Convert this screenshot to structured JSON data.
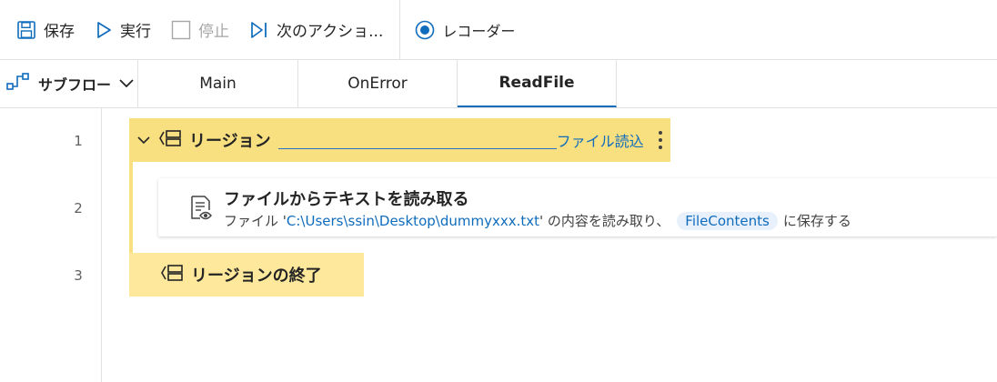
{
  "toolbar": {
    "save_label": "保存",
    "run_label": "実行",
    "stop_label": "停止",
    "next_action_label": "次のアクショ...",
    "recorder_label": "レコーダー"
  },
  "subflow": {
    "label": "サブフロー"
  },
  "tabs": [
    {
      "label": "Main",
      "active": false
    },
    {
      "label": "OnError",
      "active": false
    },
    {
      "label": "ReadFile",
      "active": true
    }
  ],
  "lines": [
    "1",
    "2",
    "3"
  ],
  "region": {
    "title": "リージョン",
    "name": "ファイル読込",
    "end_title": "リージョンの終了"
  },
  "action": {
    "title": "ファイルからテキストを読み取る",
    "desc_prefix": "ファイル '",
    "file_path": "C:\\Users\\ssin\\Desktop\\dummyxxx.txt",
    "desc_middle": "' の内容を読み取り、",
    "variable": "FileContents",
    "desc_suffix": "に保存する"
  },
  "colors": {
    "accent": "#0f6cbd",
    "region_bg": "#f8df80",
    "region_end_bg": "#fde89b",
    "disabled": "#a6a6a6"
  },
  "icons": [
    "save-icon",
    "play-icon",
    "stop-icon",
    "next-action-icon",
    "record-icon",
    "subflow-icon",
    "chevron-down-icon",
    "region-icon",
    "kebab-icon",
    "read-file-icon"
  ]
}
